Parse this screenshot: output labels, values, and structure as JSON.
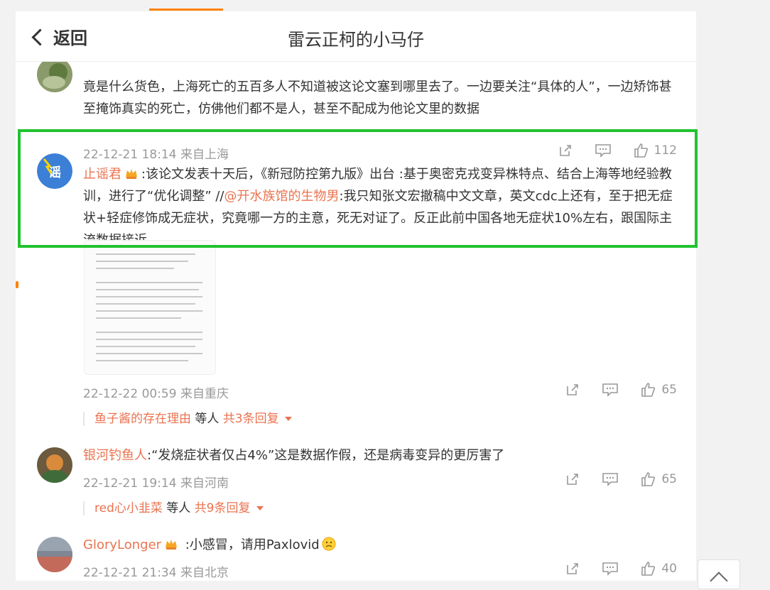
{
  "header": {
    "back_label": "返回",
    "title": "雷云正柯的小马仔"
  },
  "comments": [
    {
      "line1": "竟是什么货色，上海死亡的五百多人不知道被这论文塞到哪里去了。一边要关注“具体的人”，一边矫饰甚",
      "line2": "至掩饰真实的死亡，仿佛他们都不是人，甚至不配成为他论文里的数据",
      "meta": "22-12-21 18:14 来自上海",
      "likes": "112"
    },
    {
      "user": "止谣君",
      "text_a": ":该论文发表十天后，《新冠防控第九版》出台 :基于奥密克戎变异株特点、结合上海等地经验教训，进行了“优化调整” //",
      "mention": "@开水族馆的生物男",
      "text_b": ":我只知张文宏撤稿中文文章，英文cdc上还有，至于把无症状+轻症修饰成无症状，究竟哪一方的主意，死无对证了。反正此前中国各地无症状10%左右，跟国际主流数据接近",
      "meta": "22-12-22 00:59 来自重庆",
      "likes": "65",
      "reply_user": "鱼子酱的存在理由",
      "reply_mid": " 等人 ",
      "reply_count": "共3条回复"
    },
    {
      "user": "银河钓鱼人",
      "text": ":“发烧症状者仅占4%”这是数据作假，还是病毒变异的更厉害了",
      "meta": "22-12-21 19:14 来自河南",
      "likes": "65",
      "reply_user": "red心小韭菜",
      "reply_mid": " 等人 ",
      "reply_count": "共9条回复"
    },
    {
      "user": "GloryLonger",
      "text": " :小感冒，请用Paxlovid",
      "meta": "22-12-21 21:34 来自北京",
      "likes": "40"
    }
  ],
  "colors": {
    "accent": "#eb7350",
    "highlight": "#22c22e",
    "tab_accent": "#ff8200"
  }
}
